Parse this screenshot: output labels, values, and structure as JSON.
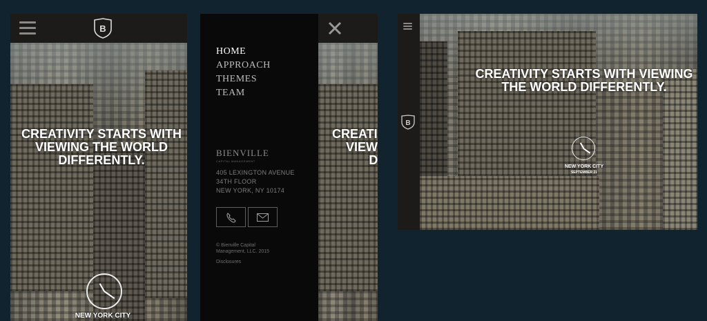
{
  "hero": {
    "headline_mobile": "CREATIVITY STARTS WITH VIEWING THE WORLD DIFFERENTLY.",
    "headline_desktop": "CREATIVITY STARTS WITH VIEWING THE WORLD DIFFERENTLY.",
    "city": "NEW YORK CITY",
    "date": "SEPTEMBER 21"
  },
  "logo": {
    "letter": "B"
  },
  "menu": {
    "items": [
      {
        "label": "HOME"
      },
      {
        "label": "APPROACH"
      },
      {
        "label": "THEMES"
      },
      {
        "label": "TEAM"
      }
    ]
  },
  "company": {
    "name": "BIENVILLE",
    "tagline": "CAPITAL MANAGEMENT",
    "address_line1": "405 LEXINGTON AVENUE",
    "address_line2": "34TH FLOOR",
    "address_line3": "NEW YORK, NY 10174",
    "copyright_line1": "© Bienville Capital",
    "copyright_line2": "Management, LLC. 2015",
    "disclosures": "Disclosures"
  },
  "icons": {
    "hamburger": "hamburger-icon",
    "close": "close-icon",
    "phone": "phone-icon",
    "mail": "mail-icon",
    "clock": "clock-icon"
  },
  "colors": {
    "background": "#10232e",
    "header": "#1d1b1a",
    "menu_panel": "#090909",
    "text": "#ffffff",
    "muted": "#7d7d7d"
  }
}
